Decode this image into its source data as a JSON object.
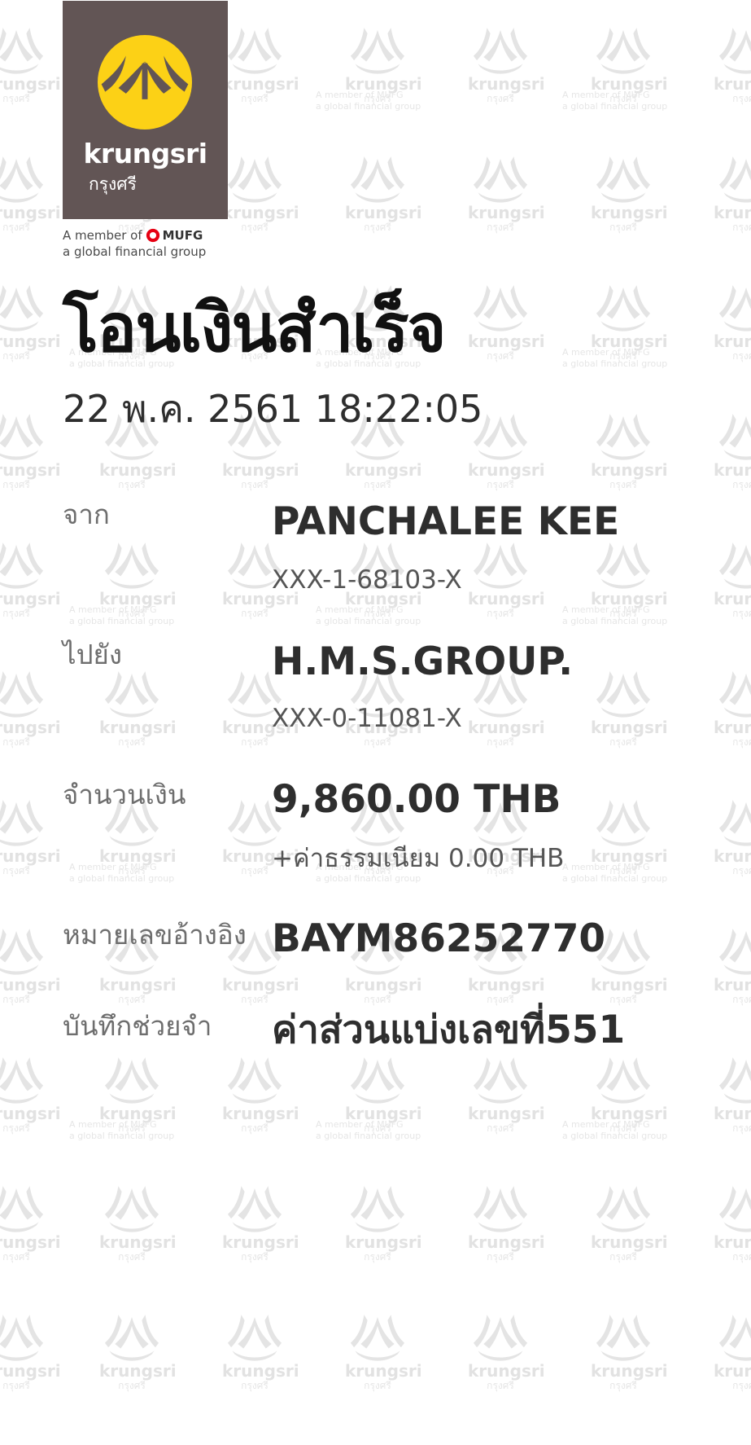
{
  "brand": {
    "logo_word": "krungsri",
    "logo_thai": "กรุงศรี",
    "member_prefix": "A member of",
    "member_brand": "MUFG",
    "member_tagline": "a global financial group",
    "logo_bg_color": "#625555",
    "logo_mark_color": "#fcd116",
    "mufg_color": "#e60012"
  },
  "receipt": {
    "title": "โอนเงินสำเร็จ",
    "datetime": "22 พ.ค. 2561 18:22:05",
    "from_label": "จาก",
    "from_name": "PANCHALEE KEE",
    "from_account": "XXX-1-68103-X",
    "to_label": "ไปยัง",
    "to_name": "H.M.S.GROUP.",
    "to_account": "XXX-0-11081-X",
    "amount_label": "จำนวนเงิน",
    "amount": "9,860.00 THB",
    "fee": "+ค่าธรรมเนียม 0.00 THB",
    "reference_label": "หมายเลขอ้างอิง",
    "reference": "BAYM86252770",
    "memo_label": "บันทึกช่วยจำ",
    "memo": "ค่าส่วนแบ่งเลขที่551"
  }
}
